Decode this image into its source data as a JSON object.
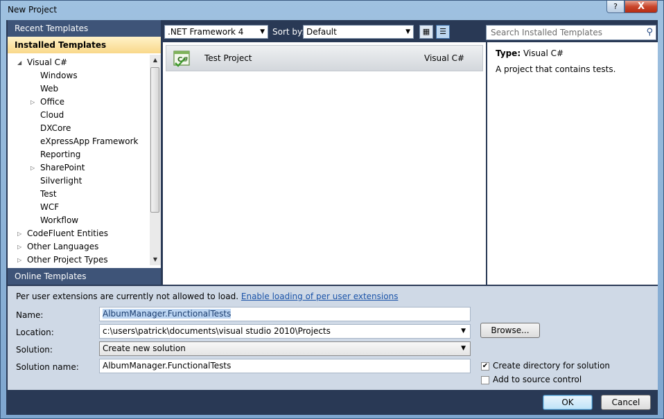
{
  "window": {
    "title": "New Project",
    "help_glyph": "?",
    "close_glyph": "X"
  },
  "left": {
    "recent_label": "Recent Templates",
    "installed_label": "Installed Templates",
    "online_label": "Online Templates",
    "tree": [
      {
        "label": "Visual C#",
        "level": 0,
        "expander": "expanded"
      },
      {
        "label": "Windows",
        "level": 1,
        "expander": "none"
      },
      {
        "label": "Web",
        "level": 1,
        "expander": "none"
      },
      {
        "label": "Office",
        "level": 1,
        "expander": "collapsed"
      },
      {
        "label": "Cloud",
        "level": 1,
        "expander": "none"
      },
      {
        "label": "DXCore",
        "level": 1,
        "expander": "none"
      },
      {
        "label": "eXpressApp Framework",
        "level": 1,
        "expander": "none"
      },
      {
        "label": "Reporting",
        "level": 1,
        "expander": "none"
      },
      {
        "label": "SharePoint",
        "level": 1,
        "expander": "collapsed"
      },
      {
        "label": "Silverlight",
        "level": 1,
        "expander": "none"
      },
      {
        "label": "Test",
        "level": 1,
        "expander": "none"
      },
      {
        "label": "WCF",
        "level": 1,
        "expander": "none"
      },
      {
        "label": "Workflow",
        "level": 1,
        "expander": "none"
      },
      {
        "label": "CodeFluent Entities",
        "level": 0,
        "expander": "collapsed"
      },
      {
        "label": "Other Languages",
        "level": 0,
        "expander": "collapsed"
      },
      {
        "label": "Other Project Types",
        "level": 0,
        "expander": "collapsed"
      }
    ]
  },
  "toolbar": {
    "framework": ".NET Framework 4",
    "sort_label": "Sort by:",
    "sort_value": "Default",
    "search_placeholder": "Search Installed Templates"
  },
  "templates": [
    {
      "name": "Test Project",
      "language": "Visual C#",
      "icon": "csharp-test-project-icon"
    }
  ],
  "description": {
    "type_label": "Type:",
    "type_value": "Visual C#",
    "text": "A project that contains tests."
  },
  "bottom": {
    "warning_text": "Per user extensions are currently not allowed to load.",
    "warning_link": "Enable loading of per user extensions",
    "name_label": "Name:",
    "name_value": "AlbumManager.FunctionalTests",
    "location_label": "Location:",
    "location_value": "c:\\users\\patrick\\documents\\visual studio 2010\\Projects",
    "browse_label": "Browse...",
    "solution_label": "Solution:",
    "solution_value": "Create new solution",
    "solution_name_label": "Solution name:",
    "solution_name_value": "AlbumManager.FunctionalTests",
    "create_dir_label": "Create directory for solution",
    "create_dir_checked": true,
    "source_control_label": "Add to source control",
    "source_control_checked": false
  },
  "footer": {
    "ok_label": "OK",
    "cancel_label": "Cancel"
  },
  "colors": {
    "header_bg": "#293955",
    "selected_header": "#f9d88a",
    "link": "#1a53a8",
    "bottom_bg": "#cfd9e6"
  }
}
